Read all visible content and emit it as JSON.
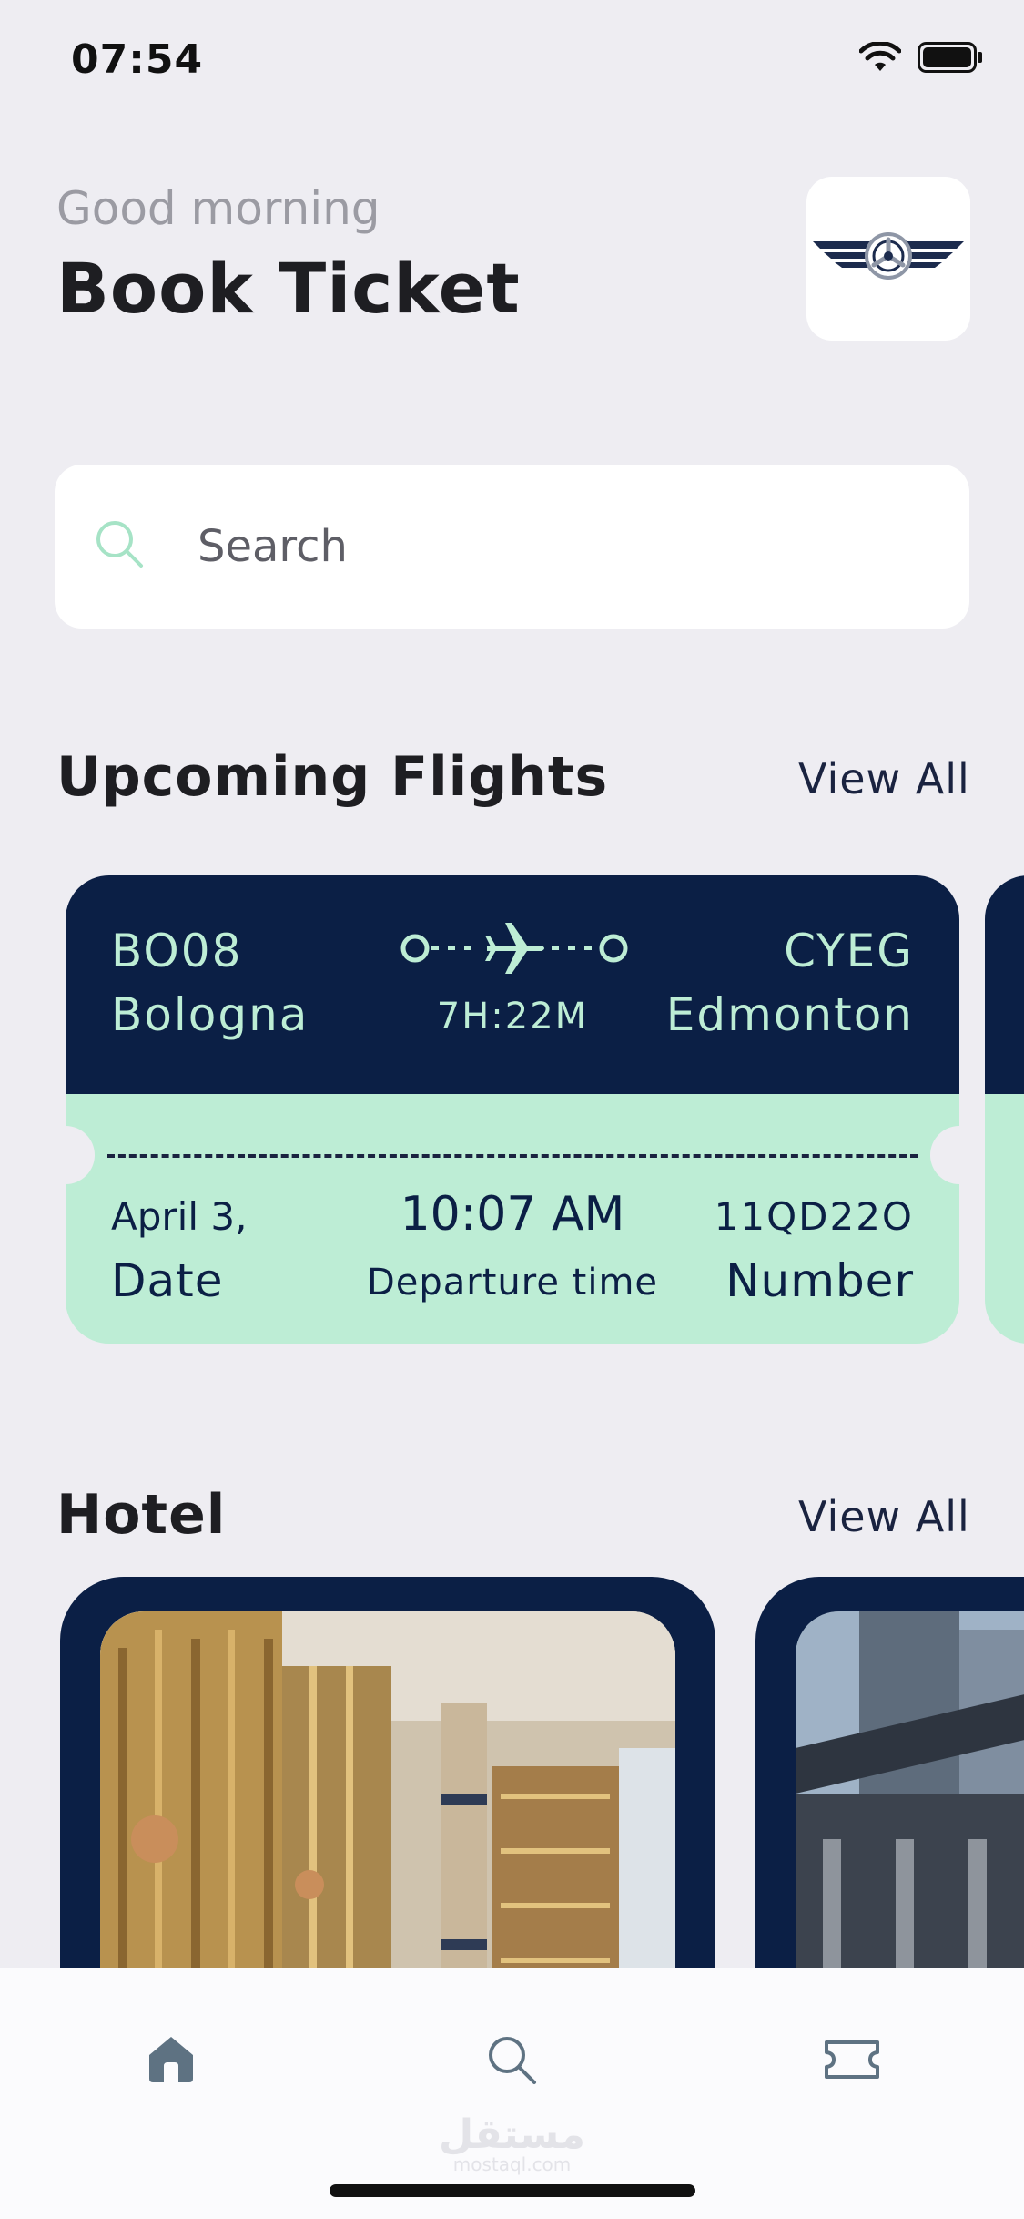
{
  "status_bar": {
    "time": "07:54"
  },
  "header": {
    "greeting": "Good morning",
    "title": "Book Ticket"
  },
  "search": {
    "placeholder": "Search"
  },
  "upcoming": {
    "title": "Upcoming Flights",
    "view_all": "View All",
    "ticket": {
      "from_code": "BO08",
      "from_city": "Bologna",
      "duration": "7H:22M",
      "to_code": "CYEG",
      "to_city": "Edmonton",
      "date_value": "April 3,",
      "date_label": "Date",
      "time_value": "10:07 AM",
      "time_label": "Departure time",
      "number_value": "11QD22O",
      "number_label": "Number"
    }
  },
  "hotel": {
    "title": "Hotel",
    "view_all": "View All"
  },
  "watermark": {
    "arabic": "مستقل",
    "latin": "mostaql.com"
  },
  "colors": {
    "navy": "#0B1F45",
    "mint": "#BDEDD5",
    "background": "#EEEDF2"
  },
  "icons": {
    "nav": [
      "home-icon",
      "search-icon",
      "ticket-icon"
    ]
  }
}
